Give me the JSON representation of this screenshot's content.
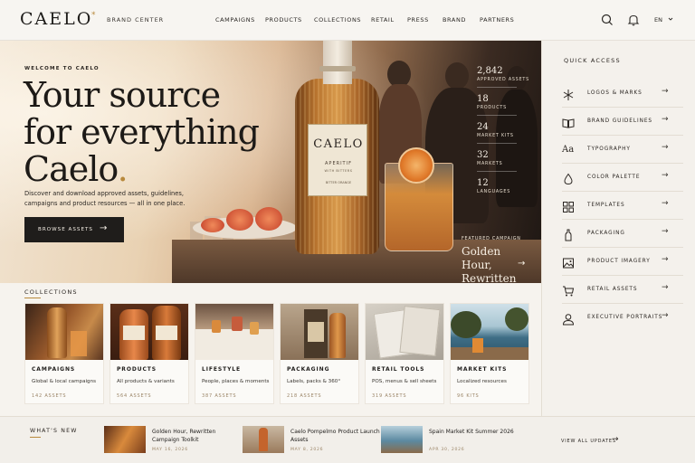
{
  "header": {
    "logo": "CAELO",
    "logo_mark": "*",
    "subtitle": "BRAND CENTER",
    "nav": [
      "CAMPAIGNS",
      "PRODUCTS",
      "COLLECTIONS",
      "RETAIL",
      "PRESS",
      "BRAND",
      "PARTNERS"
    ],
    "search_icon": "search-icon",
    "notification_icon": "bell-icon",
    "language": "EN",
    "language_icon": "chevron-down-icon"
  },
  "hero": {
    "kicker": "WELCOME TO CAELO",
    "headline_line1": "Your source",
    "headline_line2": "for everything",
    "headline_line3": "Caelo",
    "headline_dot": ".",
    "description": "Discover and download approved assets, guidelines, campaigns and product resources — all in one place.",
    "cta_label": "BROWSE ASSETS",
    "cta_icon": "arrow-right-icon",
    "bottle": {
      "brand": "CAELO",
      "line1": "APERITIF",
      "line2": "WITH BITTERS",
      "line3": "BITTER ORANGE"
    },
    "stats": [
      {
        "value": "2,842",
        "label": "APPROVED ASSETS"
      },
      {
        "value": "18",
        "label": "PRODUCTS"
      },
      {
        "value": "24",
        "label": "MARKET KITS"
      },
      {
        "value": "32",
        "label": "MARKETS"
      },
      {
        "value": "12",
        "label": "LANGUAGES"
      }
    ],
    "featured": {
      "kicker": "FEATURED CAMPAIGN",
      "title": "Golden Hour, Rewritten",
      "icon": "arrow-right-icon"
    }
  },
  "quick_access": {
    "title": "QUICK ACCESS",
    "items": [
      {
        "label": "LOGOS & MARKS",
        "icon": "logo-mark-icon"
      },
      {
        "label": "BRAND GUIDELINES",
        "icon": "book-icon"
      },
      {
        "label": "TYPOGRAPHY",
        "icon": "typography-icon"
      },
      {
        "label": "COLOR PALETTE",
        "icon": "droplet-icon"
      },
      {
        "label": "TEMPLATES",
        "icon": "grid-icon"
      },
      {
        "label": "PACKAGING",
        "icon": "bottle-icon"
      },
      {
        "label": "PRODUCT IMAGERY",
        "icon": "image-icon"
      },
      {
        "label": "RETAIL ASSETS",
        "icon": "cart-icon"
      },
      {
        "label": "EXECUTIVE PORTRAITS",
        "icon": "person-icon"
      }
    ]
  },
  "collections": {
    "title": "COLLECTIONS",
    "cards": [
      {
        "title": "CAMPAIGNS",
        "desc": "Global & local campaigns",
        "count": "142 ASSETS"
      },
      {
        "title": "PRODUCTS",
        "desc": "All products & variants",
        "count": "564 ASSETS"
      },
      {
        "title": "LIFESTYLE",
        "desc": "People, places & moments",
        "count": "387 ASSETS"
      },
      {
        "title": "PACKAGING",
        "desc": "Labels, packs & 360°",
        "count": "218 ASSETS"
      },
      {
        "title": "RETAIL TOOLS",
        "desc": "POS, menus & sell sheets",
        "count": "319 ASSETS"
      },
      {
        "title": "MARKET KITS",
        "desc": "Localized resources",
        "count": "96 KITS"
      }
    ]
  },
  "whats_new": {
    "title": "WHAT'S NEW",
    "items": [
      {
        "title": "Golden Hour, Rewritten Campaign Toolkit",
        "date": "MAY 16, 2026"
      },
      {
        "title": "Caelo Pompelmo Product Launch Assets",
        "date": "MAY 8, 2026"
      },
      {
        "title": "Spain Market Kit Summer 2026",
        "date": "APR 30, 2026"
      }
    ],
    "view_all": "VIEW ALL UPDATES",
    "view_all_icon": "arrow-right-icon"
  },
  "colors": {
    "accent": "#b8893c",
    "ink": "#1d1b19",
    "background": "#f6f3ee",
    "button": "#1f1d1b"
  }
}
